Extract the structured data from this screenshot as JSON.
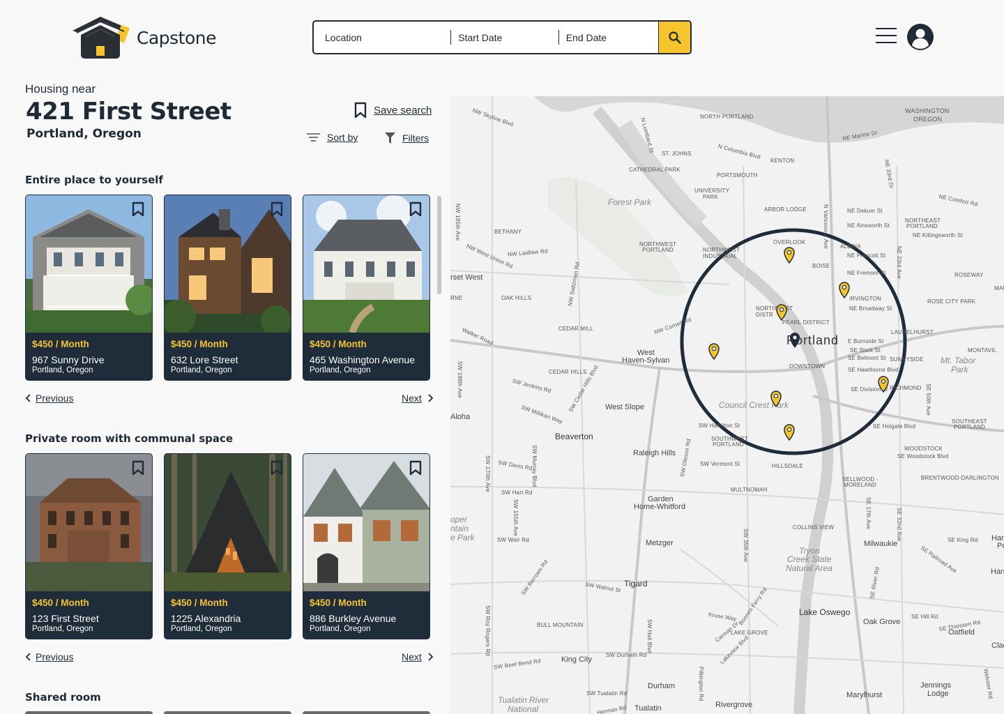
{
  "app": {
    "name": "Capstone"
  },
  "search": {
    "location_placeholder": "Location",
    "start_placeholder": "Start Date",
    "end_placeholder": "End Date"
  },
  "header": {
    "housing_near": "Housing near",
    "title": "421 First Street",
    "subtitle": "Portland, Oregon"
  },
  "actions": {
    "save_search": "Save search",
    "sort_by": "Sort by",
    "filters": "Filters"
  },
  "sections": [
    {
      "title": "Entire place to yourself",
      "listings": [
        {
          "price": "$450 / Month",
          "street": "967 Sunny Drive",
          "city": "Portland, Oregon"
        },
        {
          "price": "$450 / Month",
          "street": "632 Lore Street",
          "city": "Portland, Oregon"
        },
        {
          "price": "$450 / Month",
          "street": "465 Washington Avenue",
          "city": "Portland, Oregon"
        }
      ],
      "previous": "Previous",
      "next": "Next"
    },
    {
      "title": "Private room with communal space",
      "listings": [
        {
          "price": "$450 / Month",
          "street": "123 First Street",
          "city": "Portland, Oregon"
        },
        {
          "price": "$450 / Month",
          "street": "1225 Alexandria",
          "city": "Portland, Oregon"
        },
        {
          "price": "$450 / Month",
          "street": "886 Burkley Avenue",
          "city": "Portland, Oregon"
        }
      ],
      "previous": "Previous",
      "next": "Next"
    },
    {
      "title": "Shared room"
    }
  ],
  "map": {
    "city_label": "Portland",
    "labels": {
      "north_portland": "NORTH PORTLAND",
      "washington": "WASHINGTON",
      "oregon": "OREGON",
      "st_johns": "ST. JOHNS",
      "kenton": "KENTON",
      "cathedral_park": "CATHEDRAL PARK",
      "portsmouth": "PORTSMOUTH",
      "university": "UNIVERSITY",
      "park": "PARK",
      "arbor_lodge": "ARBOR LODGE",
      "forest_park": "Forest Park",
      "bethany": "BETHANY",
      "northwest": "NORTHWEST",
      "portland_caps": "PORTLAND",
      "northwest_industrial": "NORTHWEST INDUSTRIAL",
      "overlook": "OVERLOOK",
      "albina": "ALBINA",
      "boise": "BOISE",
      "northeast": "NORTHEAST",
      "roseway": "ROSEWAY",
      "madison": "MADISO",
      "rose_city_park": "ROSE CITY PARK",
      "irvington": "IRVINGTON",
      "sunset_west": "rset West",
      "oak_hills": "OAK HILLS",
      "rne": "RNE",
      "cedar_mill": "CEDAR MILL",
      "pearl_district": "PEARL DISTRICT",
      "northwest_district": "NORTHWEST DISTR",
      "laurelhurst": "LAURELHURST",
      "west_haven": "West",
      "haven_sylvan": "Haven-Sylvan",
      "downtown": "DOWNTOWN",
      "sunnyside": "SUNNYSIDE",
      "montavilla": "MONTAVIL",
      "mt_tabor": "Mt. Tabor",
      "tabor_park": "Park",
      "cedar_hills": "CEDAR HILLS",
      "richmond": "RICHMOND",
      "aloha": "Aloha",
      "west_slope": "West Slope",
      "council_crest": "Council Crest Park",
      "beaverton": "Beaverton",
      "southwest": "SOUTHWEST",
      "southeast": "SOUTHEAST",
      "woodstock": "WOODSTOCK",
      "raleigh_hills": "Raleigh Hills",
      "hillsdale": "HILLSDALE",
      "brentwood": "BRENTWOOD-DARLINGTON",
      "sellwood": "SELLWOOD -",
      "moreland": "MORELAND",
      "multnomah": "MULTNOMAH",
      "garden": "Garden",
      "home_whitford": "Home-Whitford",
      "collins_view": "COLLINS VIEW",
      "metzger": "Metzger",
      "milwaukie": "Milwaukie",
      "harmony": "Harmo",
      "point": "Point",
      "tryon": "Tryon",
      "creek_state": "Creek State",
      "natural_area": "Natural Area",
      "cooper": "oper",
      "ntain": "ntain",
      "e_park": "e Park",
      "tigard": "Tigard",
      "lake_oswego": "Lake Oswego",
      "oak_grove": "Oak Grove",
      "oatfield": "Oatfield",
      "bull_mountain": "BULL MOUNTAIN",
      "lake_grove": "LAKE GROVE",
      "king_city": "King City",
      "durham": "Durham",
      "marylhurst": "Marylhurst",
      "jennings": "Jennings",
      "lodge": "Lodge",
      "rivergrove": "Rivergrove",
      "tualatin": "Tualatin",
      "tualatin_river": "Tualatin River",
      "national": "National",
      "clac": "Clac"
    },
    "streets": {
      "nw_skyline": "NW Skyline Blvd",
      "n_lombard": "N Lombard St",
      "n_columbia": "N Columbia Blvd",
      "ne_marine": "NE Marine Dr",
      "ne_33rd": "NE 33rd Dr",
      "ne_comfort": "NE Comfort Rd",
      "ne_dekum": "NE Dekum St",
      "ne_ainsworth": "NE Ainsworth St",
      "ne_killingsworth": "NE Killingsworth St",
      "n_vancouver": "N Vancouver Ave",
      "ne_prescott": "NE Prescott St",
      "ne_fremont": "NE Fremont St",
      "ne_broadway": "NE Broadway St",
      "ne_33rd_ave": "NE 33rd Ave",
      "nw_185th": "NW 185th Ave",
      "nw_laidlaw": "NW Laidlaw Rd",
      "nw_west_union": "NW West Union Rd",
      "nw_saltzman": "NW Saltzman Rd",
      "nw_cornell": "NW Cornell Rd",
      "walker": "Walker Road",
      "e_burnside": "E Burnside St",
      "se_stark": "SE Stark St",
      "se_belmont": "SE Belmont St",
      "se_hawthorne": "SE Hawthorne Blvd",
      "se_division": "SE Division St",
      "se_50th": "SE 50th Ave",
      "sw_198th": "SW 198th Ave",
      "sw_jenkins": "SW Jenkins Rd",
      "sw_cedar_hills": "SW Cedar Hills Blvd",
      "sw_millikan": "SW Millikan Way",
      "sw_hamilton": "SW Hamilton St",
      "se_holgate": "SE Holgate Blvd",
      "se_woodstock": "SE Woodstock Blvd",
      "sw_170th": "SW 170th Ave",
      "sw_murray": "SW Murray Blvd",
      "sw_davis": "SW Davis Rd",
      "sw_oleson": "SW Oleson Rd",
      "sw_vermont": "SW Vermont St",
      "sw_hart": "SW Hart Rd",
      "sw_155th": "SW 155th Ave",
      "sw_weir": "SW Weir Rd",
      "se_17th": "SE 17th Ave",
      "se_32nd": "SE 32nd Ave",
      "sw_35th": "SW 35th Ave",
      "se_king": "SE King Rd",
      "se_railroad": "SE Railroad Ave",
      "sw_barrows": "SW Barrows Rd",
      "sw_walnut": "SW Walnut St",
      "se_river": "SE River Rd",
      "se_hill": "SE Hill Rd",
      "se_thiessen": "SE Thiessen Rd",
      "sw_roy_rogers": "SW Roy Rogers Rd",
      "sw_hall": "SW Hall Blvd",
      "kruse_way": "Kruse Way",
      "carman": "Carman Dr",
      "boones_ferry": "Boones Ferry Rd",
      "lakeview": "Lakeview Blvd",
      "sw_beef_bend": "SW Beef Bend Rd",
      "sw_durham": "SW Durham Rd",
      "sw_tualatin": "SW Tualatin Rd",
      "pilkington": "Pilkington Rd",
      "webster": "Webster Rd",
      "sw_herman": "Herman Rd"
    }
  },
  "colors": {
    "navy": "#1f2d3a",
    "accent": "#f6c42d"
  },
  "icons": [
    "logo-house-icon",
    "search-icon",
    "menu-icon",
    "account-icon",
    "bookmark-icon",
    "sort-icon",
    "filter-icon",
    "chevron-left-icon",
    "chevron-right-icon",
    "map-pin-icon"
  ]
}
